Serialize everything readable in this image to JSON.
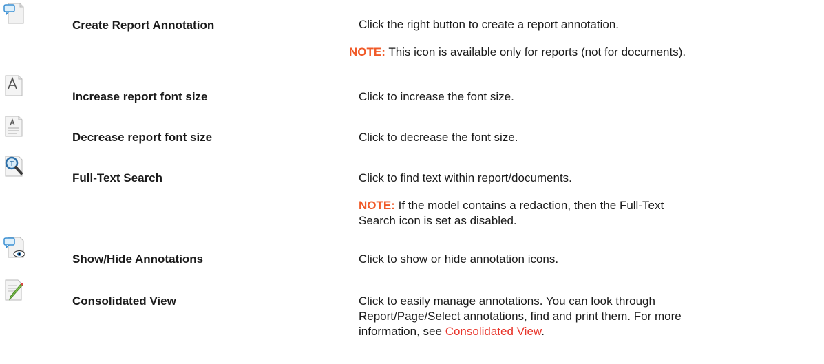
{
  "rows": [
    {
      "icon": "report-annotation-icon",
      "name": "Create Report Annotation",
      "description": "Click the right button to create a report annotation.",
      "note_label": "NOTE:",
      "note_text": "This icon is available only for reports (not for documents)."
    },
    {
      "icon": "increase-font-icon",
      "name": "Increase report font size",
      "description": "Click to increase the font size."
    },
    {
      "icon": "decrease-font-icon",
      "name": "Decrease report font size",
      "description": "Click to decrease the font size."
    },
    {
      "icon": "search-icon",
      "name": "Full-Text Search",
      "description": "Click to find text within report/documents.",
      "note_label": "NOTE:",
      "note_text": "If the model contains a redaction, then the Full-Text Search icon is set as disabled."
    },
    {
      "icon": "show-hide-annotations-icon",
      "name": "Show/Hide Annotations",
      "description": "Click to show or hide annotation icons."
    },
    {
      "icon": "consolidated-view-icon",
      "name": "Consolidated View",
      "description": "Click to easily manage annotations. You can look through Report/Page/Select annotations, find and print them. For more information, see",
      "link_text": "Consolidated View",
      "trailing": "."
    }
  ]
}
